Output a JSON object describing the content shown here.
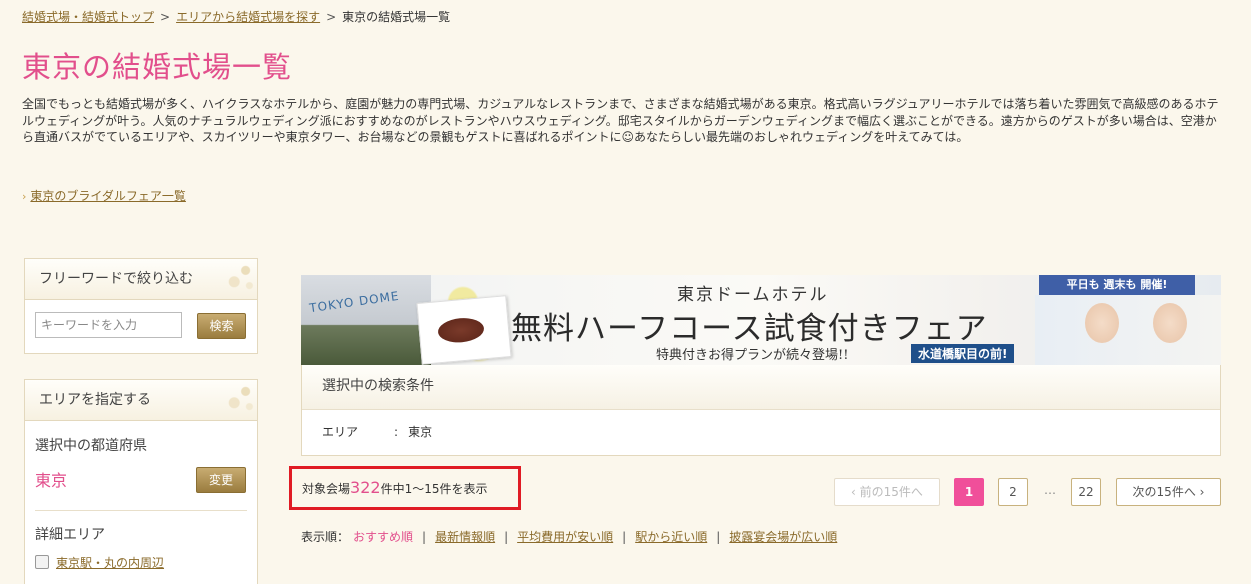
{
  "breadcrumb": {
    "items": [
      "結婚式場・結婚式トップ",
      "エリアから結婚式場を探す"
    ],
    "separator": ">",
    "current": "東京の結婚式場一覧"
  },
  "page_title": "東京の結婚式場一覧",
  "intro_text": "全国でもっとも結婚式場が多く、ハイクラスなホテルから、庭園が魅力の専門式場、カジュアルなレストランまで、さまざまな結婚式場がある東京。格式高いラグジュアリーホテルでは落ち着いた雰囲気で高級感のあるホテルウェディングが叶う。人気のナチュラルウェディング派におすすめなのがレストランやハウスウェディング。邸宅スタイルからガーデンウェディングまで幅広く選ぶことができる。遠方からのゲストが多い場合は、空港から直通バスがでているエリアや、スカイツリーや東京タワー、お台場などの景観もゲストに喜ばれるポイントに☺あなたらしい最先端のおしゃれウェディングを叶えてみては。",
  "fair_link": {
    "chevron": "›",
    "label": "東京のブライダルフェア一覧"
  },
  "freeword": {
    "title": "フリーワードで絞り込む",
    "placeholder": "キーワードを入力",
    "button": "検索"
  },
  "area": {
    "title": "エリアを指定する",
    "pref_label": "選択中の都道府県",
    "pref_value": "東京",
    "change_button": "変更",
    "detail_label": "詳細エリア",
    "options": [
      "東京駅・丸の内周辺"
    ]
  },
  "banner": {
    "dome_text": "TOKYO DOME",
    "hotel": "東京ドームホテル",
    "headline": "無料ハーフコース試食付きフェア",
    "sub": "特典付きお得プランが続々登場!!",
    "station": "水道橋駅目の前!",
    "ribbon": "平日も 週末も 開催!"
  },
  "conditions": {
    "title": "選択中の検索条件",
    "area_label": "エリア",
    "colon": ":",
    "area_value": "東京"
  },
  "results": {
    "prefix": "対象会場",
    "total": "322",
    "suffix": "件中1〜15件を表示"
  },
  "pagination": {
    "prev": "‹ 前の15件へ",
    "pages": [
      "1",
      "2",
      "22"
    ],
    "ellipsis": "…",
    "next": "次の15件へ ›",
    "current_page": "1"
  },
  "sort": {
    "label": "表示順：",
    "current": "おすすめ順",
    "separator": "|",
    "options": [
      "最新情報順",
      "平均費用が安い順",
      "駅から近い順",
      "披露宴会場が広い順"
    ]
  },
  "colors": {
    "accent_pink": "#e24f8c",
    "link_brown": "#8a6a2a",
    "gold_button": "#b0924f",
    "highlight_red": "#e01b24",
    "bg_cream": "#fbf7ec"
  }
}
